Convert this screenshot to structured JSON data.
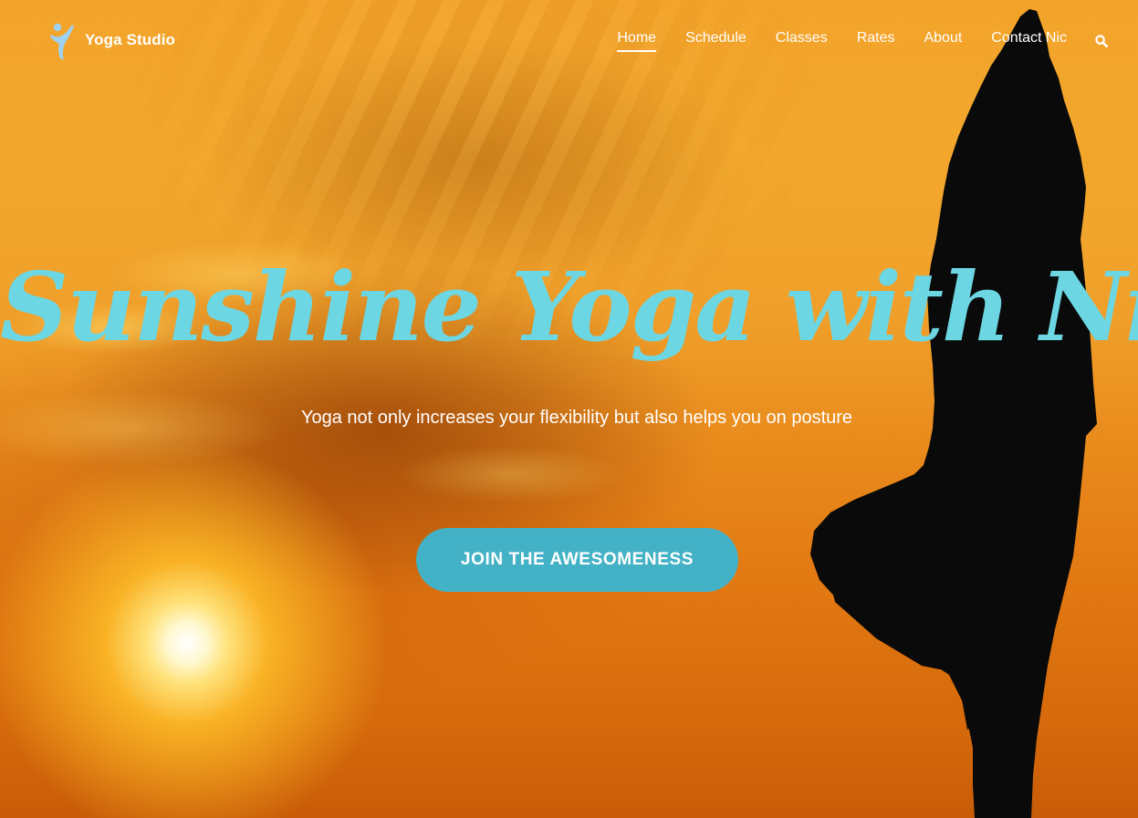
{
  "site": {
    "name": "Yoga Studio",
    "logo_icon": "yoga-figure-icon"
  },
  "nav": {
    "items": [
      {
        "label": "Home",
        "active": true
      },
      {
        "label": "Schedule",
        "active": false
      },
      {
        "label": "Classes",
        "active": false
      },
      {
        "label": "Rates",
        "active": false
      },
      {
        "label": "About",
        "active": false
      },
      {
        "label": "Contact Nic",
        "active": false
      }
    ],
    "search_icon": "search-icon"
  },
  "hero": {
    "title": "Sunshine Yoga with Nic",
    "subtitle": "Yoga not only increases your flexibility but also helps you on posture",
    "cta_label": "JOIN THE AWESOMENESS",
    "background": "sunset-sky-with-yoga-silhouette"
  },
  "colors": {
    "title": "#6dd6e3",
    "cta_background": "#44b2c6",
    "text": "#ffffff",
    "sky_top": "#f3a32a",
    "sky_bottom": "#c95c08",
    "silhouette": "#0a0a0a"
  }
}
